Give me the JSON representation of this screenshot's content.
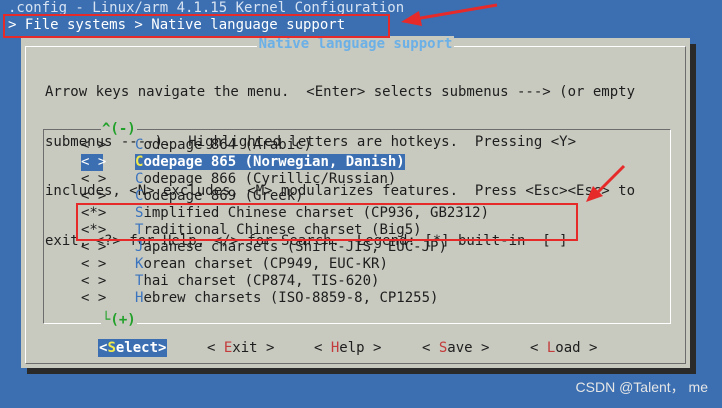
{
  "window": {
    "title": ".config - Linux/arm 4.1.15 Kernel Configuration",
    "breadcrumb": "> File systems > Native language support"
  },
  "dialog": {
    "title": "Native language support",
    "help_lines": [
      "Arrow keys navigate the menu.  <Enter> selects submenus ---> (or empty",
      "submenus ----).  Highlighted letters are hotkeys.  Pressing <Y>",
      "includes, <N> excludes, <M> modularizes features.  Press <Esc><Esc> to",
      "exit, <?> for Help, </> for Search.  Legend: [*] built-in  [ ]"
    ],
    "scroll_up": "^(-)",
    "scroll_down": "└(+)"
  },
  "menu": {
    "items": [
      {
        "mark": "< >",
        "hot": "C",
        "rest": "odepage 864 (Arabic)",
        "selected": false
      },
      {
        "mark": "< >",
        "hot": "C",
        "rest": "odepage 865 (Norwegian, Danish)",
        "selected": true
      },
      {
        "mark": "< >",
        "hot": "C",
        "rest": "odepage 866 (Cyrillic/Russian)",
        "selected": false
      },
      {
        "mark": "< >",
        "hot": "C",
        "rest": "odepage 869 (Greek)",
        "selected": false
      },
      {
        "mark": "<*>",
        "hot": "S",
        "rest": "implified Chinese charset (CP936, GB2312)",
        "selected": false
      },
      {
        "mark": "<*>",
        "hot": "T",
        "rest": "raditional Chinese charset (Big5)",
        "selected": false
      },
      {
        "mark": "< >",
        "hot": "J",
        "rest": "apanese charsets (Shift-JIS, EUC-JP)",
        "selected": false
      },
      {
        "mark": "< >",
        "hot": "K",
        "rest": "orean charset (CP949, EUC-KR)",
        "selected": false
      },
      {
        "mark": "< >",
        "hot": "T",
        "rest": "hai charset (CP874, TIS-620)",
        "selected": false
      },
      {
        "mark": "< >",
        "hot": "H",
        "rest": "ebrew charsets (ISO-8859-8, CP1255)",
        "selected": false
      }
    ]
  },
  "buttons": {
    "select": {
      "open": "<",
      "hot": "S",
      "rest": "elect",
      "close": ">"
    },
    "exit": {
      "open": "< ",
      "hot": "E",
      "rest": "xit",
      "close": " >"
    },
    "help": {
      "open": "< ",
      "hot": "H",
      "rest": "elp",
      "close": " >"
    },
    "save": {
      "open": "< ",
      "hot": "S",
      "rest": "ave",
      "close": " >"
    },
    "load": {
      "open": "< ",
      "hot": "L",
      "rest": "oad",
      "close": " >"
    }
  },
  "watermark": "CSDN @Talent， me",
  "colors": {
    "background": "#3b6fb1",
    "dialog": "#c8c9bf",
    "highlight_box": "#e62a2a",
    "hotkey_menu": "#3a74bf",
    "hotkey_button": "#c43b3b"
  }
}
